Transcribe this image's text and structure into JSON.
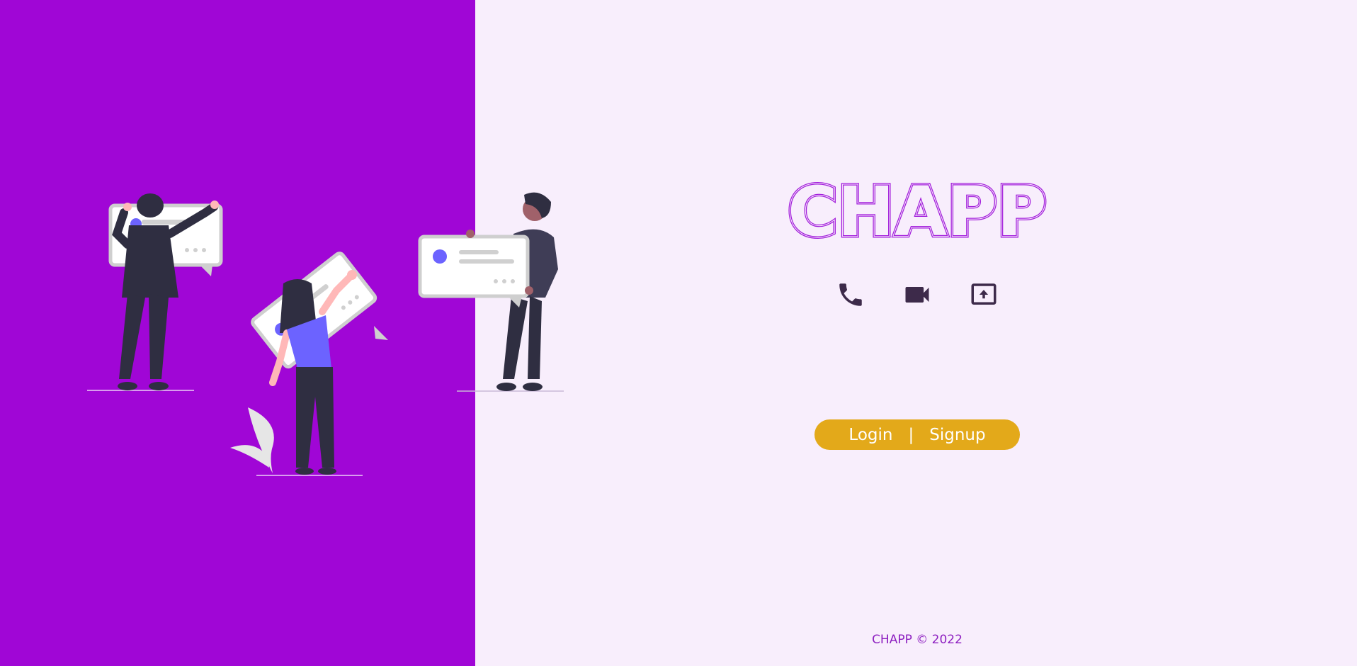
{
  "brand": {
    "logo_text": "CHAPP",
    "logo_color": "#a21cdb",
    "left_bg": "#a006d6",
    "right_bg": "#f8eefc"
  },
  "features": [
    {
      "name": "phone",
      "icon": "phone-icon"
    },
    {
      "name": "video",
      "icon": "video-camera-icon"
    },
    {
      "name": "screen-share",
      "icon": "screen-share-icon"
    }
  ],
  "auth": {
    "login_label": "Login",
    "separator": "|",
    "signup_label": "Signup",
    "pill_color": "#e3a91a"
  },
  "footer": {
    "text": "CHAPP © 2022"
  }
}
